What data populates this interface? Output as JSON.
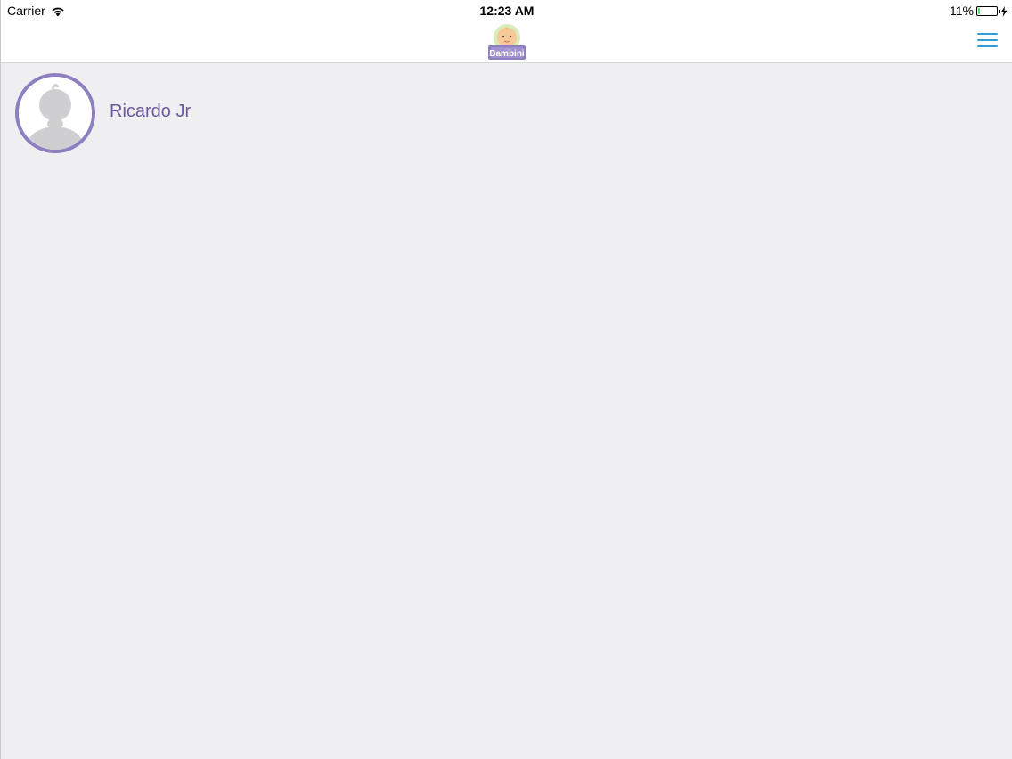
{
  "status_bar": {
    "carrier": "Carrier",
    "time": "12:23 AM",
    "battery_percent": "11%",
    "battery_level": 0.11,
    "battery_color": "#4cd964",
    "wifi_icon": "wifi-icon",
    "charging_icon": "bolt-icon"
  },
  "nav_bar": {
    "logo_text": "Bambini",
    "menu_icon": "hamburger-menu-icon",
    "accent_color": "#2f9fd6"
  },
  "children": [
    {
      "name": "Ricardo Jr",
      "avatar_icon": "baby-silhouette-icon",
      "ring_color": "#8d7fc0",
      "name_color": "#6a5aa3"
    }
  ]
}
